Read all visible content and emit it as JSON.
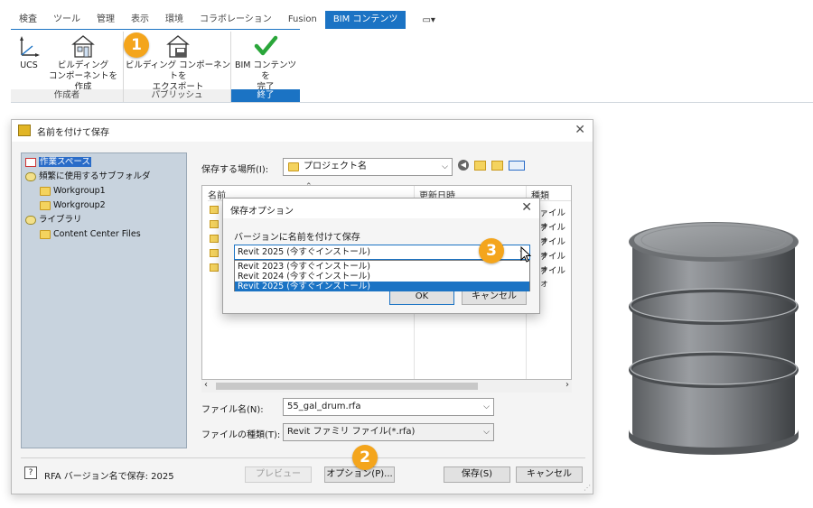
{
  "ribbon": {
    "tabs": [
      "検査",
      "ツール",
      "管理",
      "表示",
      "環境",
      "コラボレーション",
      "Fusion",
      "BIM コンテンツ"
    ],
    "active_tab": "BIM コンテンツ",
    "dropdown_glyph": "▭▾",
    "buttons": {
      "ucs": "UCS",
      "create_line1": "ビルディング",
      "create_line2": "コンポーネントを作成",
      "export_line1": "ビルディング コンポーネントを",
      "export_line2": "エクスポート",
      "finish_line1": "BIM コンテンツ を",
      "finish_line2": "完了"
    },
    "panels": {
      "author": "作成者",
      "publish": "パブリッシュ",
      "finish": "終了"
    }
  },
  "callouts": [
    "1",
    "2",
    "3"
  ],
  "save_dialog": {
    "title": "名前を付けて保存",
    "close_glyph": "✕",
    "tree": {
      "workspace": "作業スペース",
      "frequent": "頻繁に使用するサブフォルダ",
      "wg1": "Workgroup1",
      "wg2": "Workgroup2",
      "libraries": "ライブラリ",
      "content_center": "Content Center Files"
    },
    "location_label": "保存する場所(I):",
    "location_value": "プロジェクト名",
    "columns": {
      "name": "名前",
      "modified": "更新日時",
      "type": "種類"
    },
    "file_type_text": "ファイル フォ",
    "filename_label": "ファイル名(N):",
    "filename_value": "55_gal_drum.rfa",
    "filetype_label": "ファイルの種類(T):",
    "filetype_value": "Revit ファミリ ファイル(*.rfa)",
    "status_text": "RFA バージョン名で保存: 2025",
    "buttons": {
      "preview": "プレビュー",
      "options": "オプション(P)...",
      "save": "保存(S)",
      "cancel": "キャンセル"
    }
  },
  "options_dialog": {
    "title": "保存オプション",
    "close_glyph": "✕",
    "label": "バージョンに名前を付けて保存",
    "selected": "Revit 2025 (今すぐインストール)",
    "options": [
      "Revit 2023 (今すぐインストール)",
      "Revit 2024 (今すぐインストール)",
      "Revit 2025 (今すぐインストール)"
    ],
    "ok": "OK",
    "cancel": "キャンセル"
  },
  "colors": {
    "accent": "#1b73c4",
    "callout": "#f4a51c",
    "check": "#2aa63a",
    "tree_bg": "#c8d3de"
  }
}
